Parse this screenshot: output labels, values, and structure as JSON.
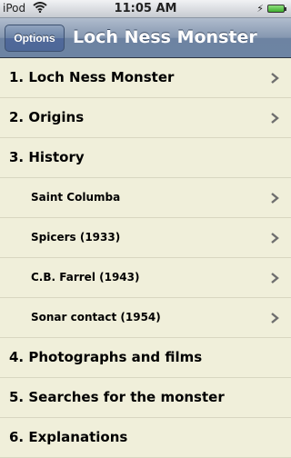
{
  "status_bar": {
    "carrier": "iPod",
    "time": "11:05 AM"
  },
  "nav_bar": {
    "options_label": "Options",
    "title": "Loch Ness Monster"
  },
  "list": {
    "items": [
      {
        "label": "1. Loch Ness Monster",
        "level": "top",
        "chevron": true
      },
      {
        "label": "2. Origins",
        "level": "top",
        "chevron": true
      },
      {
        "label": "3. History",
        "level": "top",
        "chevron": false
      },
      {
        "label": "Saint Columba",
        "level": "sub",
        "chevron": true
      },
      {
        "label": "Spicers (1933)",
        "level": "sub",
        "chevron": true
      },
      {
        "label": "C.B. Farrel (1943)",
        "level": "sub",
        "chevron": true
      },
      {
        "label": "Sonar contact (1954)",
        "level": "sub",
        "chevron": true
      },
      {
        "label": "4. Photographs and films",
        "level": "top",
        "chevron": false
      },
      {
        "label": "5. Searches for the monster",
        "level": "top",
        "chevron": false
      },
      {
        "label": "6. Explanations",
        "level": "top",
        "chevron": false
      }
    ]
  }
}
